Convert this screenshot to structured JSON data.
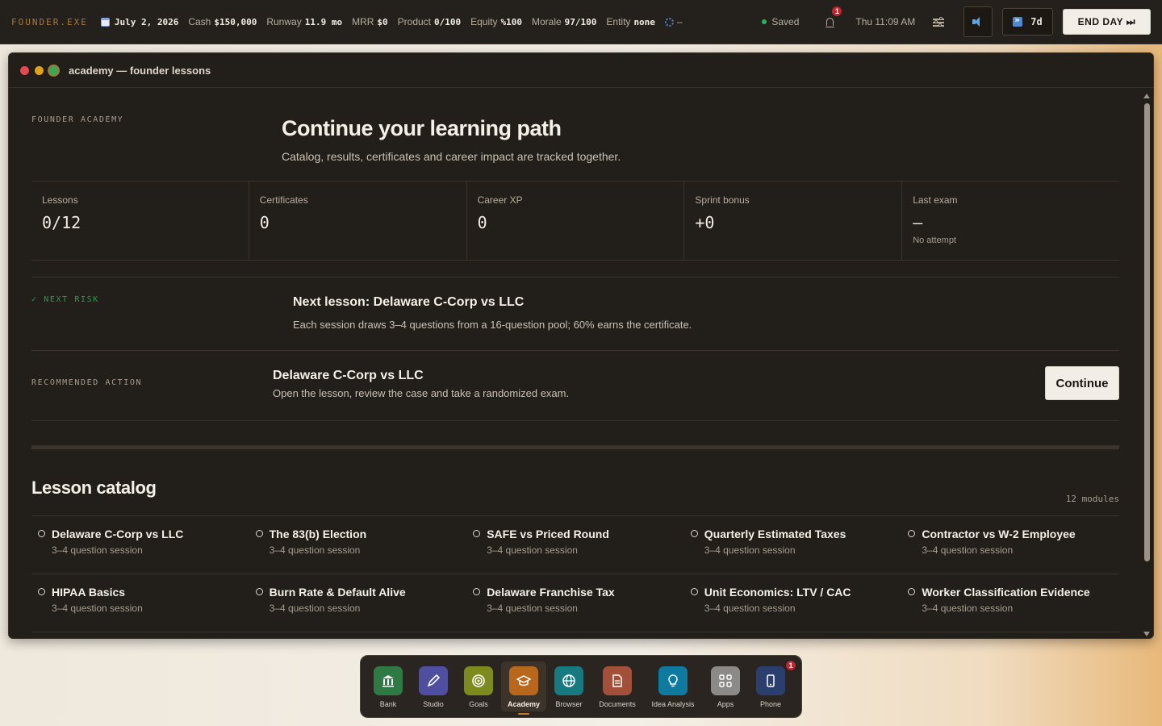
{
  "topbar": {
    "brand": "FOUNDER.EXE",
    "date": "July 2, 2026",
    "stats": [
      {
        "label": "Cash",
        "value": "$150,000"
      },
      {
        "label": "Runway",
        "value": "11.9 mo"
      },
      {
        "label": "MRR",
        "value": "$0"
      },
      {
        "label": "Product",
        "value": "0/100"
      },
      {
        "label": "Equity",
        "value": "%100"
      },
      {
        "label": "Morale",
        "value": "97/100"
      },
      {
        "label": "Entity",
        "value": "none"
      }
    ],
    "sync_value": "–",
    "saved_label": "Saved",
    "notifications_count": "1",
    "clock": "Thu 11:09 AM",
    "speed_label": "7d",
    "end_day_label": "END DAY ⏭",
    "colors": {
      "brand": "#a8773a",
      "saved_dot": "#2bb35a",
      "badge": "#c0262e"
    }
  },
  "window": {
    "title": "academy — founder lessons"
  },
  "hero": {
    "kicker": "FOUNDER ACADEMY",
    "title": "Continue your learning path",
    "subtitle": "Catalog, results, certificates and career impact are tracked together."
  },
  "metrics": [
    {
      "label": "Lessons",
      "value": "0/12",
      "sub": ""
    },
    {
      "label": "Certificates",
      "value": "0",
      "sub": ""
    },
    {
      "label": "Career XP",
      "value": "0",
      "sub": ""
    },
    {
      "label": "Sprint bonus",
      "value": "+0",
      "sub": ""
    },
    {
      "label": "Last exam",
      "value": "—",
      "sub": "No attempt"
    }
  ],
  "next_risk": {
    "tag": "✓ NEXT RISK",
    "title": "Next lesson: Delaware C-Corp vs LLC",
    "desc": "Each session draws 3–4 questions from a 16-question pool; 60% earns the certificate."
  },
  "recommended": {
    "tag": "RECOMMENDED ACTION",
    "title": "Delaware C-Corp vs LLC",
    "desc": "Open the lesson, review the case and take a randomized exam.",
    "button": "Continue"
  },
  "catalog": {
    "title": "Lesson catalog",
    "count": "12 modules",
    "rows": [
      [
        {
          "name": "Delaware C-Corp vs LLC",
          "meta": "3–4 question session"
        },
        {
          "name": "The 83(b) Election",
          "meta": "3–4 question session"
        },
        {
          "name": "SAFE vs Priced Round",
          "meta": "3–4 question session"
        },
        {
          "name": "Quarterly Estimated Taxes",
          "meta": "3–4 question session"
        },
        {
          "name": "Contractor vs W-2 Employee",
          "meta": "3–4 question session"
        }
      ],
      [
        {
          "name": "HIPAA Basics",
          "meta": "3–4 question session"
        },
        {
          "name": "Burn Rate & Default Alive",
          "meta": "3–4 question session"
        },
        {
          "name": "Delaware Franchise Tax",
          "meta": "3–4 question session"
        },
        {
          "name": "Unit Economics: LTV / CAC",
          "meta": "3–4 question session"
        },
        {
          "name": "Worker Classification Evidence",
          "meta": "3–4 question session"
        }
      ]
    ]
  },
  "dock": {
    "items": [
      {
        "label": "Bank",
        "icon": "bank-icon",
        "color": "#2f7a44"
      },
      {
        "label": "Studio",
        "icon": "pen-icon",
        "color": "#4e4fa0"
      },
      {
        "label": "Goals",
        "icon": "target-icon",
        "color": "#7d8a1e"
      },
      {
        "label": "Academy",
        "icon": "graduation-cap-icon",
        "color": "#b8671c"
      },
      {
        "label": "Browser",
        "icon": "globe-icon",
        "color": "#177a80"
      },
      {
        "label": "Documents",
        "icon": "document-icon",
        "color": "#a2503a"
      },
      {
        "label": "Idea Analysis",
        "icon": "lightbulb-icon",
        "color": "#0f7aa0"
      },
      {
        "label": "Apps",
        "icon": "grid-icon",
        "color": "#8c8a88"
      },
      {
        "label": "Phone",
        "icon": "phone-icon",
        "color": "#2a3f6e"
      }
    ],
    "phone_badge": "1"
  }
}
